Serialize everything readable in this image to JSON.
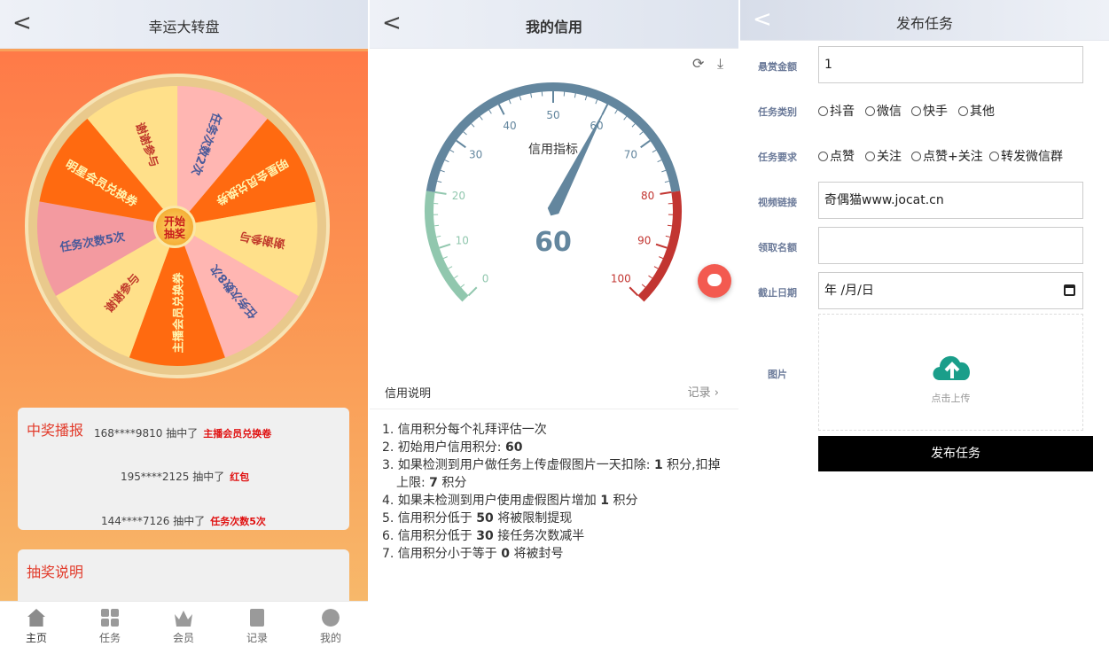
{
  "lottery": {
    "header": {
      "back": "<",
      "title": "幸运大转盘"
    },
    "wheel": {
      "center_label": "开始\n抽奖",
      "prizes": [
        "任务次数2次",
        "明星会员兑换券",
        "谢谢参与",
        "任务次数8次",
        "主播会员兑换券",
        "谢谢参与",
        "任务次数5次",
        "明星会员兑换券",
        "谢谢参与"
      ]
    },
    "winners": {
      "title": "中奖播报",
      "items": [
        {
          "user": "168****9810 抽中了",
          "prize": "主播会员兑换卷"
        },
        {
          "user": "195****2125 抽中了",
          "prize": "红包"
        },
        {
          "user": "144****7126 抽中了",
          "prize": "任务次数5次"
        }
      ]
    },
    "rules_title": "抽奖说明",
    "tabs": [
      {
        "label": "主页",
        "icon": "home-icon"
      },
      {
        "label": "任务",
        "icon": "grid-icon"
      },
      {
        "label": "会员",
        "icon": "crown-icon"
      },
      {
        "label": "记录",
        "icon": "clipboard-icon"
      },
      {
        "label": "我的",
        "icon": "user-icon"
      }
    ]
  },
  "credit": {
    "header": {
      "back": "<",
      "title": "我的信用"
    },
    "gauge": {
      "title": "信用指标",
      "value": 60,
      "min": 0,
      "max": 100,
      "ticks": [
        "0",
        "10",
        "20",
        "30",
        "40",
        "50",
        "60",
        "70",
        "80",
        "90",
        "100"
      ],
      "colors": {
        "low": "#91c7ae",
        "mid": "#63869e",
        "high": "#c23531"
      }
    },
    "section": {
      "left": "信用说明",
      "right": "记录"
    },
    "rules": [
      [
        "1. 信用积分每个礼拜评估一次"
      ],
      [
        "2. 初始用户信用积分: ",
        "60"
      ],
      [
        "3. 如果检测到用户做任务上传虚假图片一天扣除: ",
        "1",
        " 积分,扣掉上限: ",
        "7",
        " 积分"
      ],
      [
        "4. 如果未检测到用户使用虚假图片增加 ",
        "1",
        " 积分"
      ],
      [
        "5. 信用积分低于 ",
        "50",
        " 将被限制提现"
      ],
      [
        "6. 信用积分低于 ",
        "30",
        " 接任务次数减半"
      ],
      [
        "7. 信用积分小于等于 ",
        "0",
        " 将被封号"
      ]
    ]
  },
  "publish": {
    "header": {
      "back": "<",
      "title": "发布任务"
    },
    "reward": {
      "label": "悬赏金额",
      "value": "1"
    },
    "category": {
      "label": "任务类别",
      "options": [
        "抖音",
        "微信",
        "快手",
        "其他"
      ]
    },
    "requirement": {
      "label": "任务要求",
      "options": [
        "点赞",
        "关注",
        "点赞+关注",
        "转发微信群"
      ]
    },
    "video": {
      "label": "视频链接",
      "value": "奇偶猫www.jocat.cn"
    },
    "quota": {
      "label": "领取名额",
      "value": ""
    },
    "deadline": {
      "label": "截止日期",
      "value": "年 /月/日"
    },
    "image": {
      "label": "图片",
      "upload": "点击上传"
    },
    "submit": "发布任务"
  }
}
